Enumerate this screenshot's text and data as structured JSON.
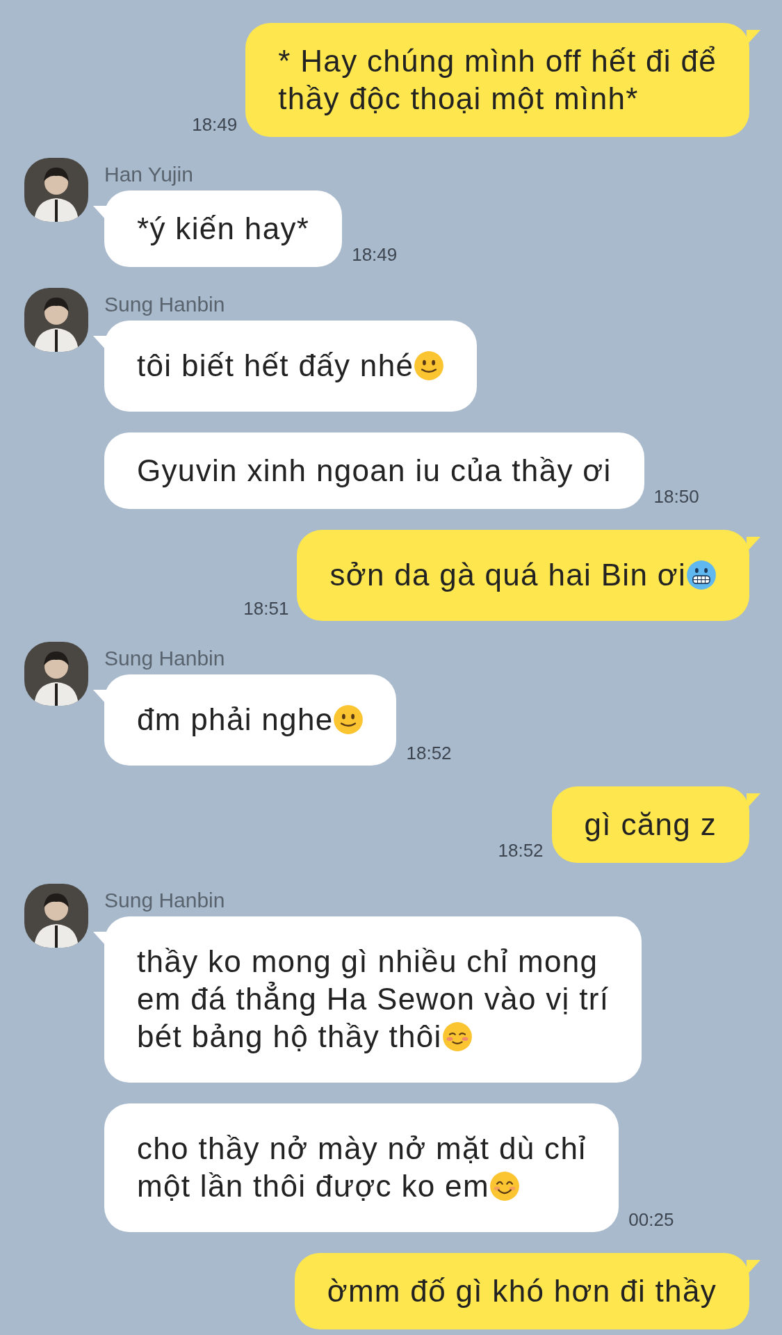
{
  "messages": [
    {
      "kind": "sent",
      "lines": [
        "* Hay chúng mình off hết đi để",
        "thầy độc thoại một mình*"
      ],
      "time": "18:49"
    },
    {
      "kind": "received",
      "sender": "Han Yujin",
      "lines": [
        "*ý kiến hay*"
      ],
      "time": "18:49"
    },
    {
      "kind": "received",
      "sender": "Sung Hanbin",
      "lines": [
        "tôi biết hết đấy nhé"
      ],
      "emoji": {
        "kind": "smile"
      }
    },
    {
      "kind": "received",
      "lines": [
        "Gyuvin xinh ngoan iu của thầy ơi"
      ],
      "time": "18:50"
    },
    {
      "kind": "sent",
      "lines": [
        "sởn da gà quá hai Bin ơi"
      ],
      "emoji": {
        "kind": "cold"
      },
      "time": "18:51"
    },
    {
      "kind": "received",
      "sender": "Sung Hanbin",
      "lines": [
        "đm phải nghe"
      ],
      "emoji": {
        "kind": "smile"
      },
      "time": "18:52"
    },
    {
      "kind": "sent",
      "lines": [
        "gì căng z"
      ],
      "time": "18:52"
    },
    {
      "kind": "received",
      "sender": "Sung Hanbin",
      "lines": [
        "thầy ko mong gì nhiều chỉ mong",
        "em đá thẳng Ha Sewon vào vị trí",
        "bét bảng hộ thầy thôi"
      ],
      "emoji": {
        "kind": "blush"
      }
    },
    {
      "kind": "received",
      "lines": [
        "cho thầy nở mày nở mặt dù chỉ",
        "một lần thôi được ko em"
      ],
      "emoji": {
        "kind": "happy"
      },
      "time": "00:25"
    },
    {
      "kind": "sent",
      "lines": [
        "ờmm đố gì khó hơn đi thầy"
      ]
    }
  ]
}
